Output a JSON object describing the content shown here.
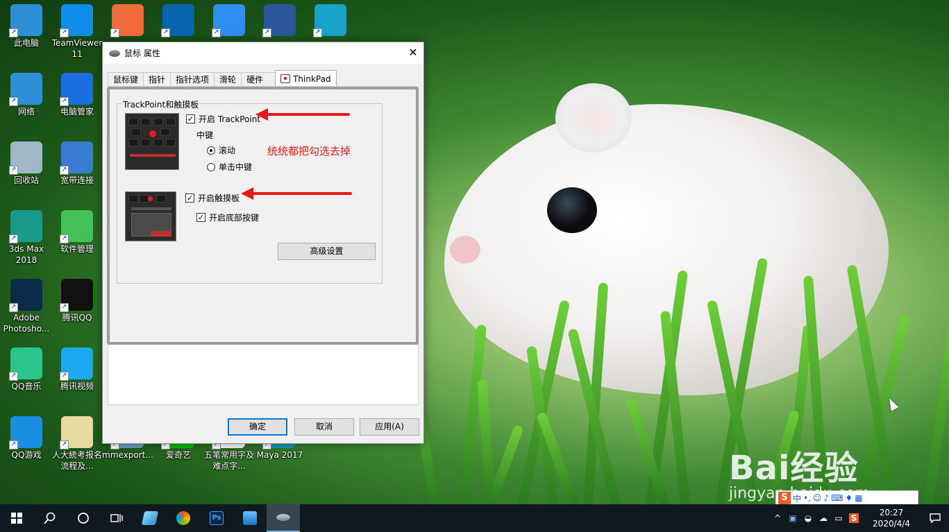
{
  "desktop": {
    "icons": [
      {
        "label": "此电脑",
        "icon": "computer-icon",
        "color": "#2d8fd5"
      },
      {
        "label": "TeamViewer 11",
        "icon": "teamviewer-icon",
        "color": "#0e8ee9"
      },
      {
        "label": "",
        "icon": "photos-pinwheel-icon",
        "color": "#f26b3a"
      },
      {
        "label": "",
        "icon": "outlook-icon",
        "color": "#0a64ad"
      },
      {
        "label": "",
        "icon": "baidu-netdisk-icon",
        "color": "#2f8ff1"
      },
      {
        "label": "",
        "icon": "word-icon",
        "color": "#2b579a"
      },
      {
        "label": "",
        "icon": "autodesk-icon",
        "color": "#1aa3c8"
      },
      {
        "label": "网络",
        "icon": "network-icon",
        "color": "#2d8fd5"
      },
      {
        "label": "电脑管家",
        "icon": "pc-manager-icon",
        "color": "#1b6fe0"
      },
      {
        "label": "回收站",
        "icon": "recycle-bin-icon",
        "color": "#9fb8c8"
      },
      {
        "label": "宽带连接",
        "icon": "broadband-icon",
        "color": "#3a7bd5"
      },
      {
        "label": "3ds Max 2018",
        "icon": "3dsmax-icon",
        "color": "#1a9a8a"
      },
      {
        "label": "软件管理",
        "icon": "software-manager-icon",
        "color": "#43c25a"
      },
      {
        "label": "Adobe Photosho...",
        "icon": "photoshop-icon",
        "color": "#0c2a4a"
      },
      {
        "label": "腾讯QQ",
        "icon": "qq-icon",
        "color": "#111111"
      },
      {
        "label": "QQ音乐",
        "icon": "qq-music-icon",
        "color": "#2bc48a"
      },
      {
        "label": "腾讯视频",
        "icon": "tencent-video-icon",
        "color": "#1aa8f0"
      },
      {
        "label": "QQ游戏",
        "icon": "qq-game-icon",
        "color": "#1a8ee0"
      },
      {
        "label": "人大統考报名流程及...",
        "icon": "word-doc-icon",
        "color": "#e8d9a0"
      },
      {
        "label": "mmexport...",
        "icon": "image-file-icon",
        "color": "#6aa0c0"
      },
      {
        "label": "爱奇艺",
        "icon": "iqiyi-icon",
        "color": "#00be06"
      },
      {
        "label": "五笔常用字及难点字...",
        "icon": "doc-file-icon",
        "color": "#ffffff"
      },
      {
        "label": "Maya 2017",
        "icon": "maya-icon",
        "color": "#1a9ab8"
      }
    ]
  },
  "dialog": {
    "title": "鼠标 属性",
    "tabs": [
      "鼠标键",
      "指针",
      "指针选项",
      "滑轮",
      "硬件",
      "ThinkPad"
    ],
    "active_tab": "ThinkPad",
    "group_title": "TrackPoint和触摸板",
    "trackpoint": {
      "label": "开启 TrackPoint",
      "checked": true
    },
    "middle_key": {
      "label": "中键",
      "options": [
        {
          "label": "滚动",
          "selected": true
        },
        {
          "label": "单击中键",
          "selected": false
        }
      ]
    },
    "touchpad": {
      "label": "开启触摸板",
      "checked": true
    },
    "bottom_buttons": {
      "label": "开启底部按键",
      "checked": true
    },
    "advanced_button": "高级设置",
    "ok_button": "确定",
    "cancel_button": "取消",
    "apply_button": "应用(A)"
  },
  "annotation": {
    "text": "统统都把勾选去掉",
    "color": "#e81818"
  },
  "watermark": {
    "logo": "Bai经验",
    "url": "jingyan.baidu.com"
  },
  "ime_bar": {
    "mode": "中"
  },
  "taskbar": {
    "time": "20:27",
    "date": "2020/4/4",
    "pinned": [
      "windows-start-icon",
      "search-icon",
      "cortana-icon",
      "task-view-icon",
      "app-icon",
      "photos-icon",
      "photoshop-icon",
      "control-panel-icon",
      "mouse-icon"
    ]
  }
}
